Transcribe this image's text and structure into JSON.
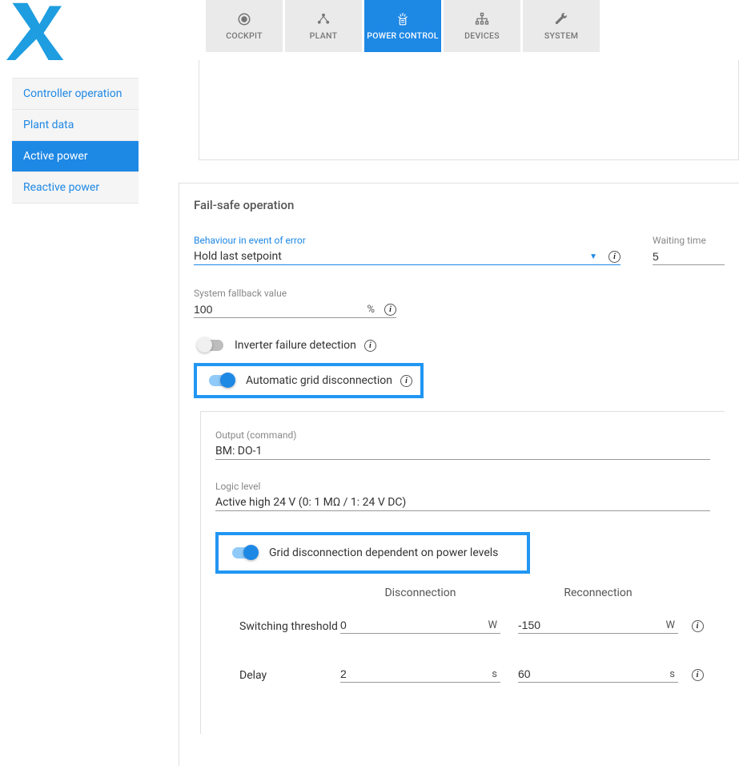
{
  "nav": {
    "tabs": [
      {
        "label": "COCKPIT"
      },
      {
        "label": "PLANT"
      },
      {
        "label": "POWER CONTROL"
      },
      {
        "label": "DEVICES"
      },
      {
        "label": "SYSTEM"
      }
    ]
  },
  "sidebar": {
    "items": [
      {
        "label": "Controller operation"
      },
      {
        "label": "Plant data"
      },
      {
        "label": "Active power"
      },
      {
        "label": "Reactive power"
      }
    ]
  },
  "card": {
    "title": "Fail-safe operation",
    "behaviour_label": "Behaviour in event of error",
    "behaviour_value": "Hold last setpoint",
    "waiting_label": "Waiting time",
    "waiting_value": "5",
    "fallback_label": "System fallback value",
    "fallback_value": "100",
    "fallback_unit": "%",
    "toggle_inverter": "Inverter failure detection",
    "toggle_auto_grid": "Automatic grid disconnection"
  },
  "inner": {
    "output_label": "Output (command)",
    "output_value": "BM: DO-1",
    "logic_label": "Logic level",
    "logic_value": "Active high 24 V (0: 1 MΩ / 1: 24 V DC)",
    "toggle_grid_power": "Grid disconnection dependent on power levels",
    "col_disconnect": "Disconnection",
    "col_reconnect": "Reconnection",
    "row_threshold": "Switching threshold",
    "row_delay": "Delay",
    "threshold_disc": "0",
    "threshold_reco": "-150",
    "threshold_unit": "W",
    "delay_disc": "2",
    "delay_reco": "60",
    "delay_unit": "s"
  }
}
